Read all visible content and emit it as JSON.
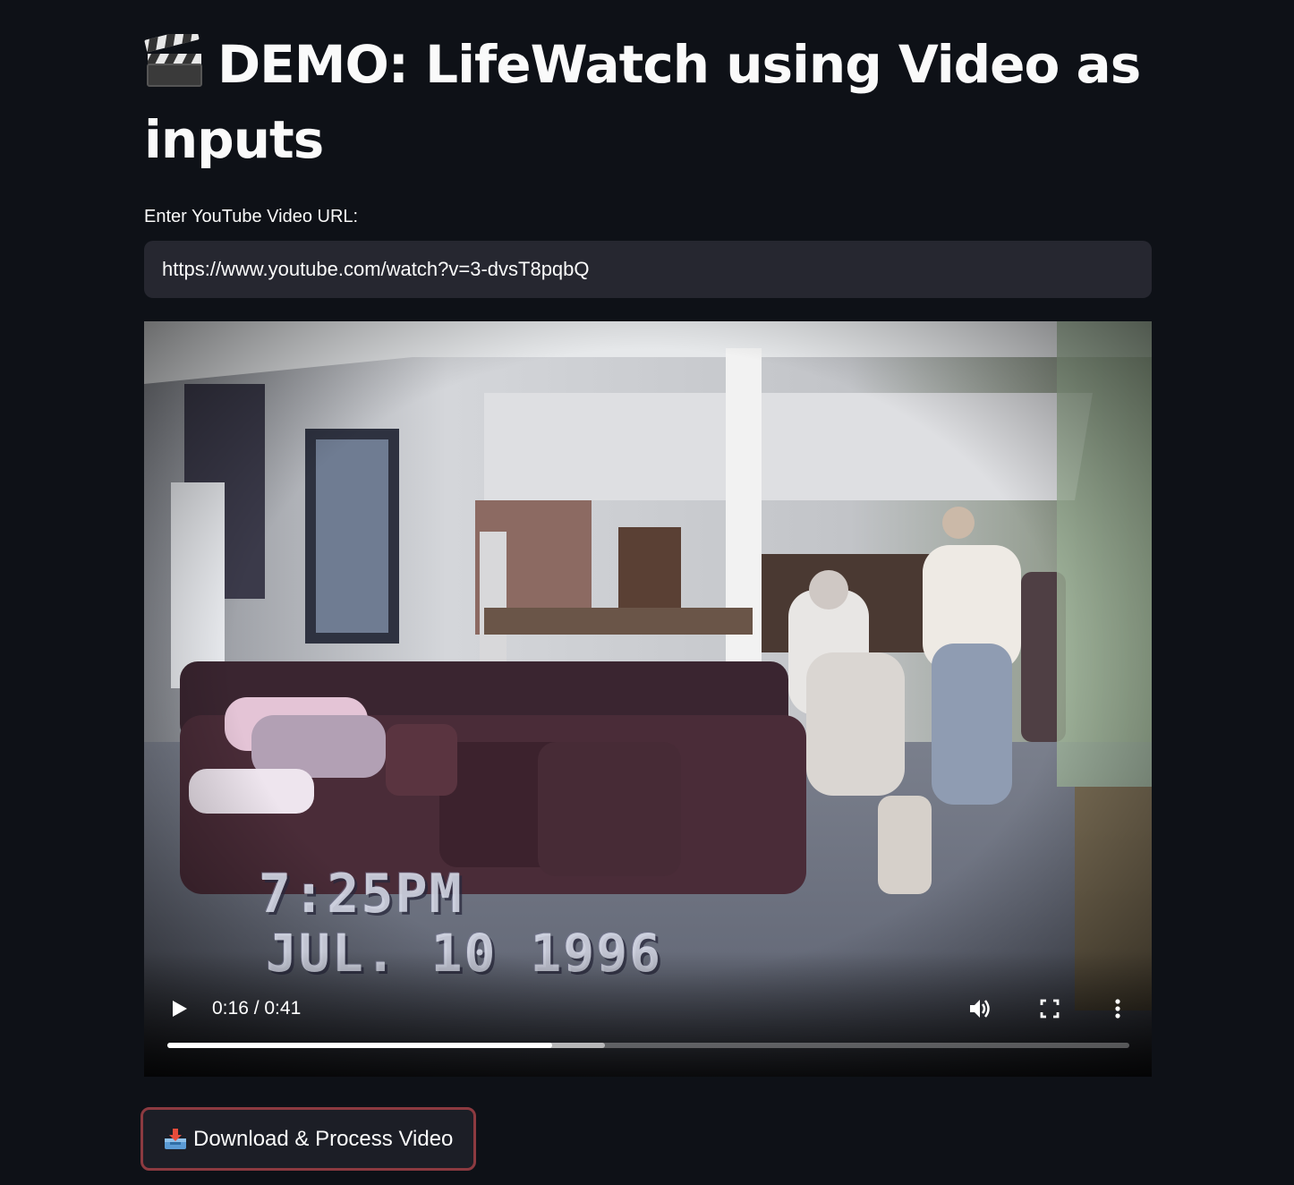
{
  "title": {
    "emoji_icon": "clapper-board-icon",
    "text": "DEMO: LifeWatch using Video as inputs"
  },
  "url_input": {
    "label": "Enter YouTube Video URL:",
    "value": "https://www.youtube.com/watch?v=3-dvsT8pqbQ"
  },
  "video": {
    "overlay_time": "7:25PM",
    "overlay_date": "JUL. 10 1996",
    "time_display": "0:16 / 0:41",
    "played_fraction": 0.4,
    "buffered_fraction": 0.455,
    "icons": {
      "play": "play-icon",
      "volume": "volume-icon",
      "fullscreen": "fullscreen-icon",
      "menu": "more-options-icon"
    }
  },
  "process_button": {
    "icon": "inbox-tray-icon",
    "label": "Download & Process Video",
    "border_color": "#8c3a40"
  },
  "colors": {
    "background": "#0e1117",
    "input_bg": "#262730",
    "text": "#fafafa"
  }
}
